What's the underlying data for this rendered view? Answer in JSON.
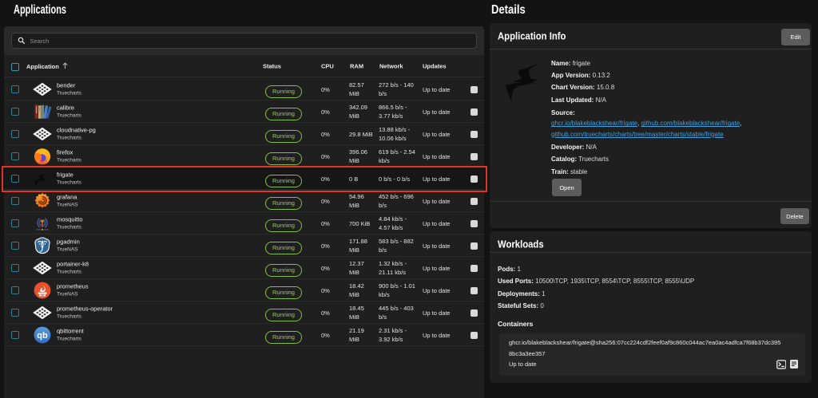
{
  "page": {
    "left_title": "Applications",
    "right_title": "Details"
  },
  "search": {
    "placeholder": "Search"
  },
  "table": {
    "columns": [
      "Application",
      "Status",
      "CPU",
      "RAM",
      "Network",
      "Updates"
    ],
    "sort": {
      "column": "Application",
      "direction": "asc"
    },
    "rows": [
      {
        "name": "bender",
        "catalog": "Truecharts",
        "icon": "lattice",
        "status": "Running",
        "cpu": "0%",
        "ram": "82.57 MiB",
        "network": "272 b/s - 140 b/s",
        "updates": "Up to date",
        "highlighted": false
      },
      {
        "name": "calibre",
        "catalog": "Truecharts",
        "icon": "calibre",
        "status": "Running",
        "cpu": "0%",
        "ram": "342.09 MiB",
        "network": "866.5 b/s - 3.77 kb/s",
        "updates": "Up to date",
        "highlighted": false
      },
      {
        "name": "cloudnative-pg",
        "catalog": "Truecharts",
        "icon": "lattice",
        "status": "Running",
        "cpu": "0%",
        "ram": "29.8 MiB",
        "network": "13.88 kb/s - 10.06 kb/s",
        "updates": "Up to date",
        "highlighted": false
      },
      {
        "name": "firefox",
        "catalog": "Truecharts",
        "icon": "firefox",
        "status": "Running",
        "cpu": "0%",
        "ram": "396.06 MiB",
        "network": "619 b/s - 2.54 kb/s",
        "updates": "Up to date",
        "highlighted": false
      },
      {
        "name": "frigate",
        "catalog": "Truecharts",
        "icon": "frigate",
        "status": "Running",
        "cpu": "0%",
        "ram": "0 B",
        "network": "0 b/s - 0 b/s",
        "updates": "Up to date",
        "highlighted": true
      },
      {
        "name": "grafana",
        "catalog": "TrueNAS",
        "icon": "grafana",
        "status": "Running",
        "cpu": "0%",
        "ram": "54.96 MiB",
        "network": "452 b/s - 696 b/s",
        "updates": "Up to date",
        "highlighted": false
      },
      {
        "name": "mosquitto",
        "catalog": "Truecharts",
        "icon": "mosquitto",
        "status": "Running",
        "cpu": "0%",
        "ram": "700 KiB",
        "network": "4.84 kb/s - 4.57 kb/s",
        "updates": "Up to date",
        "highlighted": false
      },
      {
        "name": "pgadmin",
        "catalog": "TrueNAS",
        "icon": "pgadmin",
        "status": "Running",
        "cpu": "0%",
        "ram": "171.88 MiB",
        "network": "583 b/s - 882 b/s",
        "updates": "Up to date",
        "highlighted": false
      },
      {
        "name": "portainer-k8",
        "catalog": "Truecharts",
        "icon": "lattice",
        "status": "Running",
        "cpu": "0%",
        "ram": "12.37 MiB",
        "network": "1.32 kb/s - 21.11 kb/s",
        "updates": "Up to date",
        "highlighted": false
      },
      {
        "name": "prometheus",
        "catalog": "TrueNAS",
        "icon": "prometheus",
        "status": "Running",
        "cpu": "0%",
        "ram": "18.42 MiB",
        "network": "900 b/s - 1.01 kb/s",
        "updates": "Up to date",
        "highlighted": false
      },
      {
        "name": "prometheus-operator",
        "catalog": "Truecharts",
        "icon": "lattice",
        "status": "Running",
        "cpu": "0%",
        "ram": "18.45 MiB",
        "network": "445 b/s - 403 b/s",
        "updates": "Up to date",
        "highlighted": false
      },
      {
        "name": "qbittorrent",
        "catalog": "Truecharts",
        "icon": "qbittorrent",
        "status": "Running",
        "cpu": "0%",
        "ram": "21.19 MiB",
        "network": "2.31 kb/s - 3.92 kb/s",
        "updates": "Up to date",
        "highlighted": false
      }
    ]
  },
  "app_info": {
    "title": "Application Info",
    "edit_label": "Edit",
    "fields": [
      {
        "label": "Name:",
        "value": "frigate"
      },
      {
        "label": "App Version:",
        "value": "0.13.2"
      },
      {
        "label": "Chart Version:",
        "value": "15.0.8"
      },
      {
        "label": "Last Updated:",
        "value": "N/A"
      }
    ],
    "source_label": "Source:",
    "links": [
      "ghcr.io/blakeblackshear/frigate",
      "github.com/blakeblackshear/frigate",
      "github.com/truecharts/charts/tree/master/charts/stable/frigate"
    ],
    "developer_label": "Developer:",
    "developer": "N/A",
    "catalog_label": "Catalog:",
    "catalog": "Truecharts",
    "train_label": "Train:",
    "train": "stable",
    "open_label": "Open",
    "delete_label": "Delete"
  },
  "workloads": {
    "title": "Workloads",
    "stats": [
      {
        "label": "Pods:",
        "value": "1"
      },
      {
        "label": "Used Ports:",
        "value": "10500\\TCP, 1935\\TCP, 8554\\TCP, 8555\\TCP, 8555\\UDP"
      },
      {
        "label": "Deployments:",
        "value": "1"
      },
      {
        "label": "Stateful Sets:",
        "value": "0"
      }
    ],
    "containers_label": "Containers",
    "container_image": "ghcr.io/blakeblackshear/frigate@sha256:07cc224cdf2feef0af9c860c044ac7ea0ac4adfca7f68b37dc3958bc3a3ee357",
    "container_status": "Up to date"
  },
  "colors": {
    "accent_green": "#84bf41",
    "highlight_red": "#dd3626",
    "checkbox_teal": "#2e7f8e",
    "link_blue": "#41a0d9"
  }
}
